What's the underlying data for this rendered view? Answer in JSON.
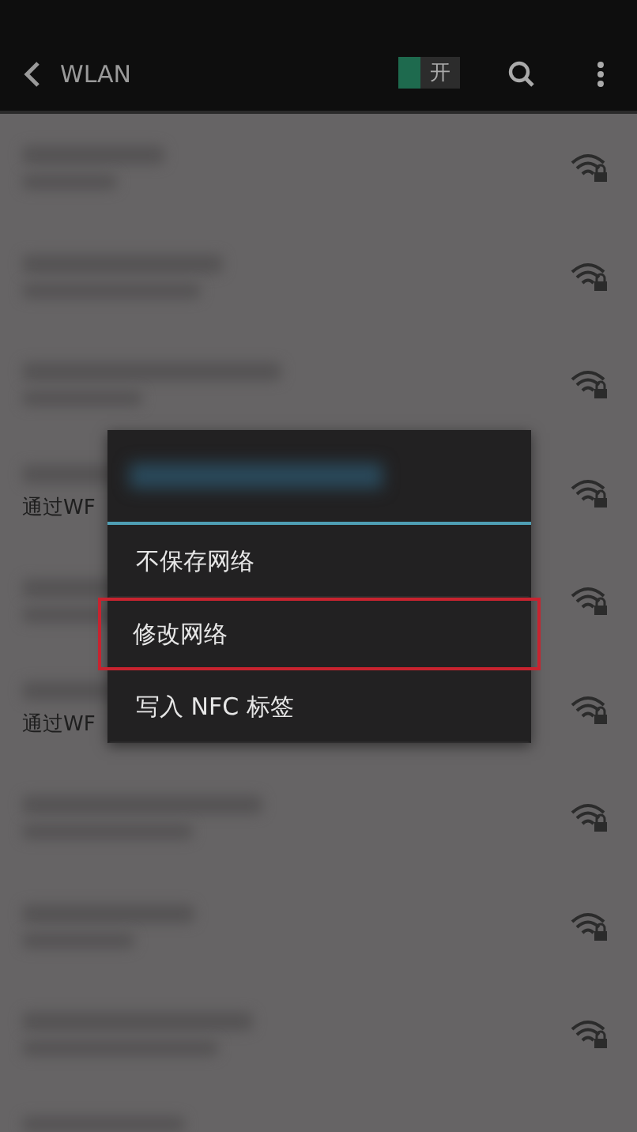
{
  "app_bar": {
    "title": "WLAN",
    "switch": {
      "label": "开",
      "on": true
    }
  },
  "networks": [
    {
      "kind": "blurred"
    },
    {
      "kind": "blurred"
    },
    {
      "kind": "blurred"
    },
    {
      "kind": "partial",
      "subtitle": "通过WF"
    },
    {
      "kind": "blurred"
    },
    {
      "kind": "partial",
      "subtitle": "通过WF"
    },
    {
      "kind": "blurred"
    },
    {
      "kind": "blurred"
    },
    {
      "kind": "blurred"
    },
    {
      "kind": "cut"
    }
  ],
  "dialog": {
    "items": [
      {
        "label": "不保存网络",
        "highlighted": false
      },
      {
        "label": "修改网络",
        "highlighted": true
      },
      {
        "label": "写入 NFC 标签",
        "highlighted": false
      }
    ]
  }
}
